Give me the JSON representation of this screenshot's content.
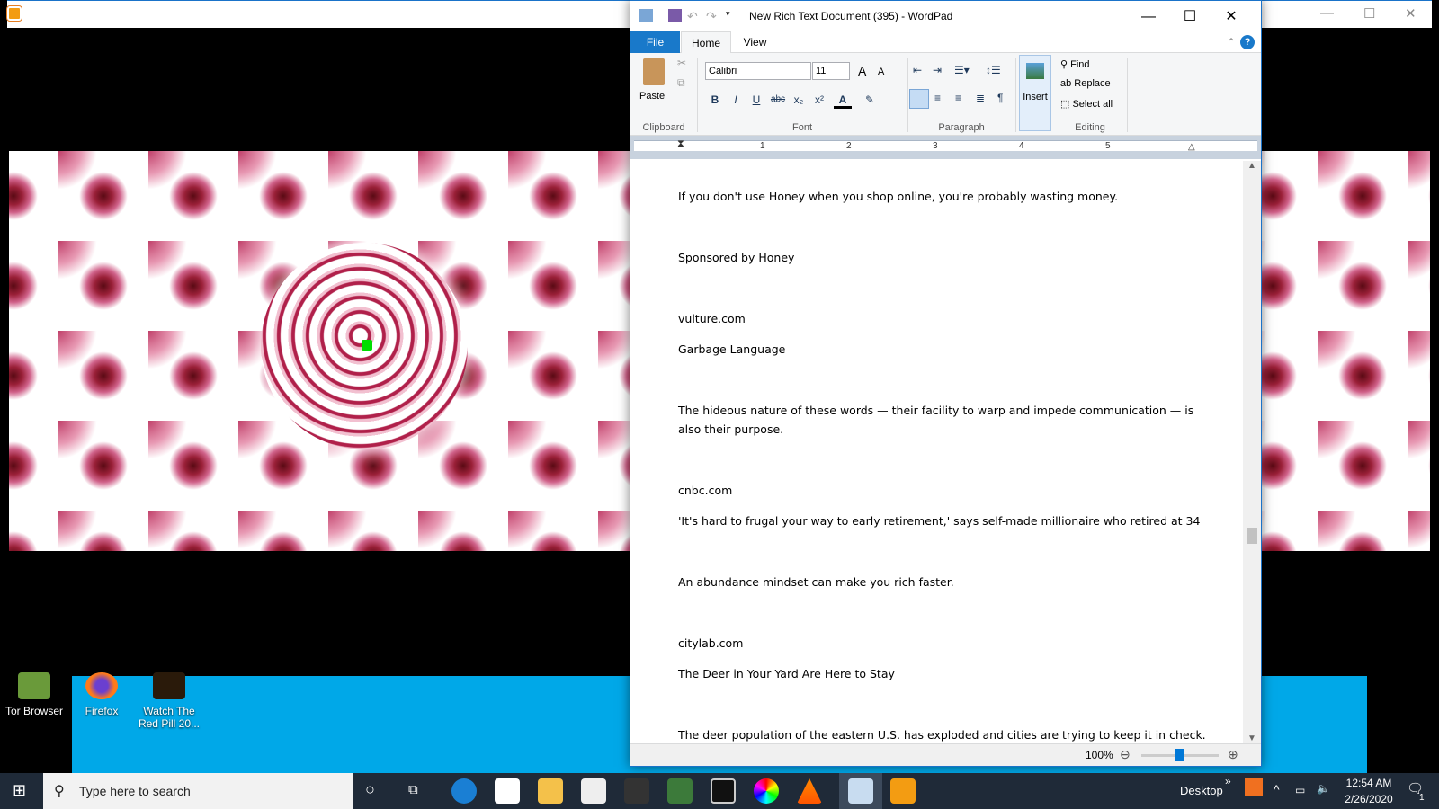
{
  "background_window": {
    "controls": [
      "—",
      "☐",
      "✕"
    ]
  },
  "desktop": {
    "icons": [
      {
        "label": "Tor Browser"
      },
      {
        "label": "Firefox"
      },
      {
        "label": "Watch The Red Pill 20..."
      }
    ]
  },
  "wordpad": {
    "title": "New Rich Text Document (395) - WordPad",
    "controls": {
      "minimize": "—",
      "maximize": "☐",
      "close": "✕"
    },
    "tabs": [
      "File",
      "Home",
      "View"
    ],
    "ribbon": {
      "clipboard": {
        "paste": "Paste",
        "group": "Clipboard"
      },
      "font": {
        "family": "Calibri",
        "size": "11",
        "group": "Font",
        "buttons": [
          "B",
          "I",
          "U",
          "abc",
          "x₂",
          "x²"
        ]
      },
      "paragraph": {
        "group": "Paragraph"
      },
      "insert": {
        "label": "Insert"
      },
      "editing": {
        "find": "Find",
        "replace": "Replace",
        "select_all": "Select all",
        "group": "Editing"
      }
    },
    "ruler": [
      "1",
      "2",
      "3",
      "4",
      "5"
    ],
    "document": [
      "If you don't use Honey when you shop online, you're probably wasting money.",
      "Sponsored by Honey",
      "vulture.com",
      "Garbage Language",
      "The hideous nature of these words — their facility to warp and impede communication — is also their purpose.",
      "cnbc.com",
      "'It's hard to frugal your way to early retirement,' says self-made millionaire who retired at 34",
      "An abundance mindset can make you rich faster.",
      "citylab.com",
      "The Deer in Your Yard Are Here to Stay",
      "The deer population of the eastern U.S. has exploded and cities are trying to keep it in check."
    ],
    "zoom": {
      "label": "100%",
      "value": 100
    }
  },
  "taskbar": {
    "search_placeholder": "Type here to search",
    "desktop_label": "Desktop",
    "time": "12:54 AM",
    "date": "2/26/2020",
    "notifications": "1",
    "accent": "#0078d7"
  }
}
